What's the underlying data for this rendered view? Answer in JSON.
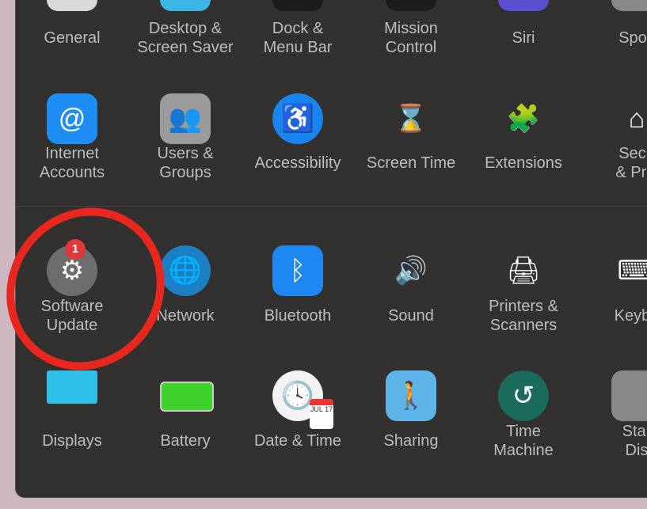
{
  "rows": [
    [
      {
        "id": "general",
        "label": [
          "General"
        ],
        "icon": "general-icon",
        "bg": "#d9d9d9"
      },
      {
        "id": "desktop-screen-saver",
        "label": [
          "Desktop &",
          "Screen Saver"
        ],
        "icon": "desktop-icon",
        "bg": "#3bb4e6"
      },
      {
        "id": "dock-menu-bar",
        "label": [
          "Dock &",
          "Menu Bar"
        ],
        "icon": "dock-icon",
        "bg": "#1c1c1c"
      },
      {
        "id": "mission-control",
        "label": [
          "Mission",
          "Control"
        ],
        "icon": "mission-control-icon",
        "bg": "#1c1c1c"
      },
      {
        "id": "siri",
        "label": [
          "Siri"
        ],
        "icon": "siri-icon",
        "bg": "#5a4fcf"
      },
      {
        "id": "spotlight",
        "label": [
          "Spotl"
        ],
        "icon": "spotlight-icon",
        "bg": "#888"
      }
    ],
    [
      {
        "id": "internet-accounts",
        "label": [
          "Internet",
          "Accounts"
        ],
        "icon": "at-icon",
        "glyph": "@",
        "bg": "#1e8ef5"
      },
      {
        "id": "users-groups",
        "label": [
          "Users &",
          "Groups"
        ],
        "icon": "users-icon",
        "glyph": "👥",
        "bg": "#9a9a9a"
      },
      {
        "id": "accessibility",
        "label": [
          "Accessibility"
        ],
        "icon": "accessibility-icon",
        "glyph": "♿",
        "bg": "#1a84f0",
        "round": true
      },
      {
        "id": "screen-time",
        "label": [
          "Screen Time"
        ],
        "icon": "hourglass-icon",
        "glyph": "⌛",
        "bg": "transparent"
      },
      {
        "id": "extensions",
        "label": [
          "Extensions"
        ],
        "icon": "puzzle-icon",
        "glyph": "🧩",
        "bg": "transparent"
      },
      {
        "id": "security-privacy",
        "label": [
          "Secu",
          "& Priv"
        ],
        "icon": "house-lock-icon",
        "glyph": "⌂",
        "bg": "transparent"
      }
    ],
    [
      {
        "id": "software-update",
        "label": [
          "Software",
          "Update"
        ],
        "icon": "gear-icon",
        "glyph": "⚙",
        "bg": "#6d6d6d",
        "round": true,
        "badge": "1"
      },
      {
        "id": "network",
        "label": [
          "Network"
        ],
        "icon": "globe-icon",
        "glyph": "🌐",
        "bg": "#1c7fc4",
        "round": true
      },
      {
        "id": "bluetooth",
        "label": [
          "Bluetooth"
        ],
        "icon": "bluetooth-icon",
        "glyph": "ᛒ",
        "bg": "#1f87f2"
      },
      {
        "id": "sound",
        "label": [
          "Sound"
        ],
        "icon": "speaker-icon",
        "glyph": "🔊",
        "bg": "transparent"
      },
      {
        "id": "printers-scanners",
        "label": [
          "Printers &",
          "Scanners"
        ],
        "icon": "printer-icon",
        "glyph": "🖨",
        "bg": "transparent"
      },
      {
        "id": "keyboard",
        "label": [
          "Keybo"
        ],
        "icon": "keyboard-icon",
        "glyph": "⌨",
        "bg": "transparent"
      }
    ],
    [
      {
        "id": "displays",
        "label": [
          "Displays"
        ],
        "icon": "display-icon",
        "glyph": "",
        "bg": "#2ec0e8"
      },
      {
        "id": "battery",
        "label": [
          "Battery"
        ],
        "icon": "battery-icon",
        "glyph": "",
        "bg": "#3fd12c"
      },
      {
        "id": "date-time",
        "label": [
          "Date & Time"
        ],
        "icon": "clock-icon",
        "glyph": "🕓",
        "bg": "#f2f2f2",
        "round": true,
        "cal": "JUL 17"
      },
      {
        "id": "sharing",
        "label": [
          "Sharing"
        ],
        "icon": "folder-icon",
        "glyph": "🚶",
        "bg": "#5eb3e8"
      },
      {
        "id": "time-machine",
        "label": [
          "Time",
          "Machine"
        ],
        "icon": "time-machine-icon",
        "glyph": "↺",
        "bg": "#1a6b5a",
        "round": true
      },
      {
        "id": "startup-disk",
        "label": [
          "Star",
          "Dis"
        ],
        "icon": "disk-icon",
        "glyph": "",
        "bg": "#888"
      }
    ]
  ],
  "annotation_color": "#e8271f"
}
